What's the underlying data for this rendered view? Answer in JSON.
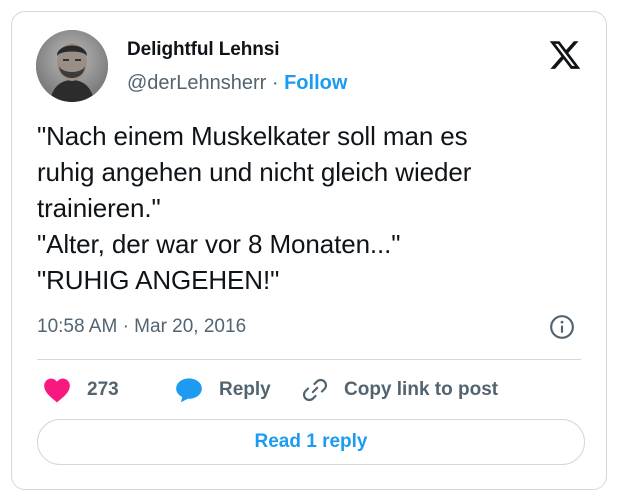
{
  "author": {
    "name": "Delightful Lehnsi",
    "handle": "@derLehnsherr",
    "separator": "·",
    "follow_label": "Follow"
  },
  "tweet": {
    "text": "\"Nach einem Muskelkater soll man es\nruhig angehen und nicht gleich wieder\ntrainieren.\"\n\"Alter, der war vor 8 Monaten...\"\n\"RUHIG ANGEHEN!\"",
    "time": "10:58 AM",
    "date": "Mar 20, 2016",
    "separator": "·"
  },
  "actions": {
    "like_count": "273",
    "reply_label": "Reply",
    "copy_label": "Copy link to post"
  },
  "read_replies_label": "Read 1 reply",
  "icons": {
    "logo": "x-logo-icon",
    "info": "info-icon",
    "like": "heart-icon",
    "reply": "speech-bubble-icon",
    "copy": "link-icon"
  },
  "colors": {
    "accent": "#1d9bf0",
    "heart": "#f91880",
    "secondary_text": "#536471",
    "border": "#cfd9de"
  }
}
